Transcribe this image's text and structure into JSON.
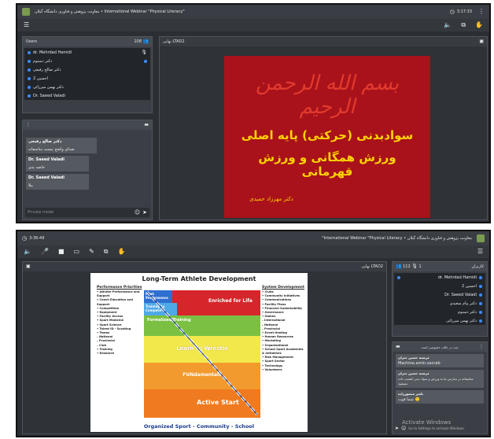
{
  "top": {
    "title": "معاونت پژوهش و فناوری دانشگاه گیلان • International Webinar \"Physical Literacy\"",
    "time": "3:17:33",
    "users_panel": {
      "header": "Users",
      "count": "108",
      "users": [
        "dr. Mehrdad Hamidi",
        "دکتر دستوم",
        "دکتر صالح رفیعی",
        "احسین 2",
        "دکتر بهمن میرزائی",
        "Dr. Saeed Valadi"
      ]
    },
    "presentation_header": "نهایی LTAD2",
    "chat": {
      "messages": [
        {
          "name": "دکتر صالح رفیعی",
          "text": "صدای واضح نیست متاسفانه"
        },
        {
          "name": "Dr. Saeed Valadi",
          "text": "خاصه بدی"
        },
        {
          "name": "Dr. Saeed Valadi",
          "text": "ببلا"
        }
      ],
      "input_placeholder": "Private mode"
    },
    "slide": {
      "calligraphy": "بسم الله الرحمن الرحیم",
      "title_line1": "سوادبدنی (حرکتی) پایه اصلی",
      "title_line2": "ورزش همگانی و ورزش قهرمانی",
      "author": "دکتر مهرزاد حمیدی"
    },
    "colors": {
      "slide_bg": "#a9121a",
      "title_text": "#ffd400",
      "calligraphy": "#e23a2f"
    }
  },
  "bottom": {
    "time": "3:36:49",
    "title": "\"International Webinar \"Physical Literacy • معاونت پژوهش و فناوری دانشگاه گیلان",
    "presentation_header": "نهایی LTAD2",
    "users_panel": {
      "header": "کاربران",
      "count": "112",
      "mic_count": "1",
      "users": [
        "dr. Mehrdad Hamidi",
        "احسین 2",
        "Dr. Saeed Valadi",
        "دکتر پیام سعیدی",
        "دکتر دستوم",
        "دکتر بهمن میرزائی"
      ]
    },
    "chat": {
      "header": "چت در حالت خصوصی است",
      "messages": [
        {
          "name": "مرضیه حسین جبران",
          "text": "Machine.amin.vacrab"
        },
        {
          "name": "مرضیه حسین جبران",
          "text": "متاسفانه در مدارس ما به ورزش و سواد بدنی اهمیت داده نمیشود"
        },
        {
          "name": "تامیر منصورزاده",
          "text": "شما قوت 🙂"
        }
      ],
      "watermark_line1": "Activate Windows",
      "watermark_line2": "Go to Settings to activate Windows."
    },
    "ltad": {
      "title": "Long-Term Athlete Development",
      "left_heading": "Performance Priorities",
      "left_items": [
        "• Athlete Performance and Support",
        "• Coach Education and Support",
        "• Competition",
        "• Equipment",
        "• Facility Access",
        "• Sport Medicine",
        "• Sport Science",
        "• Talent ID - Scouting",
        "• Teams",
        "  – National",
        "  – Provincial",
        "  – Club",
        "• Training",
        "• Research"
      ],
      "right_heading": "System Development",
      "right_items": [
        "• Clubs",
        "• Community Initiatives",
        "• Communications",
        "• Facility Plans",
        "• Financial Sustainability",
        "• Governance",
        "• Games",
        "  – International",
        "  – National",
        "  – Provincial",
        "• Event Hosting",
        "• Human Resources",
        "• Marketing",
        "• Organizational",
        "• School Sport Academies & Initiatives",
        "• Risk Management",
        "• Sport Sector",
        "• Technology",
        "• Volunteers"
      ],
      "stages": [
        "Peak Performance",
        "Training to Compete",
        "Enriched for Life",
        "Formalized Training",
        "Learn to Wrestle",
        "FUNdamentals",
        "Active Start"
      ],
      "footer": "Organized Sport - Community - School"
    }
  }
}
